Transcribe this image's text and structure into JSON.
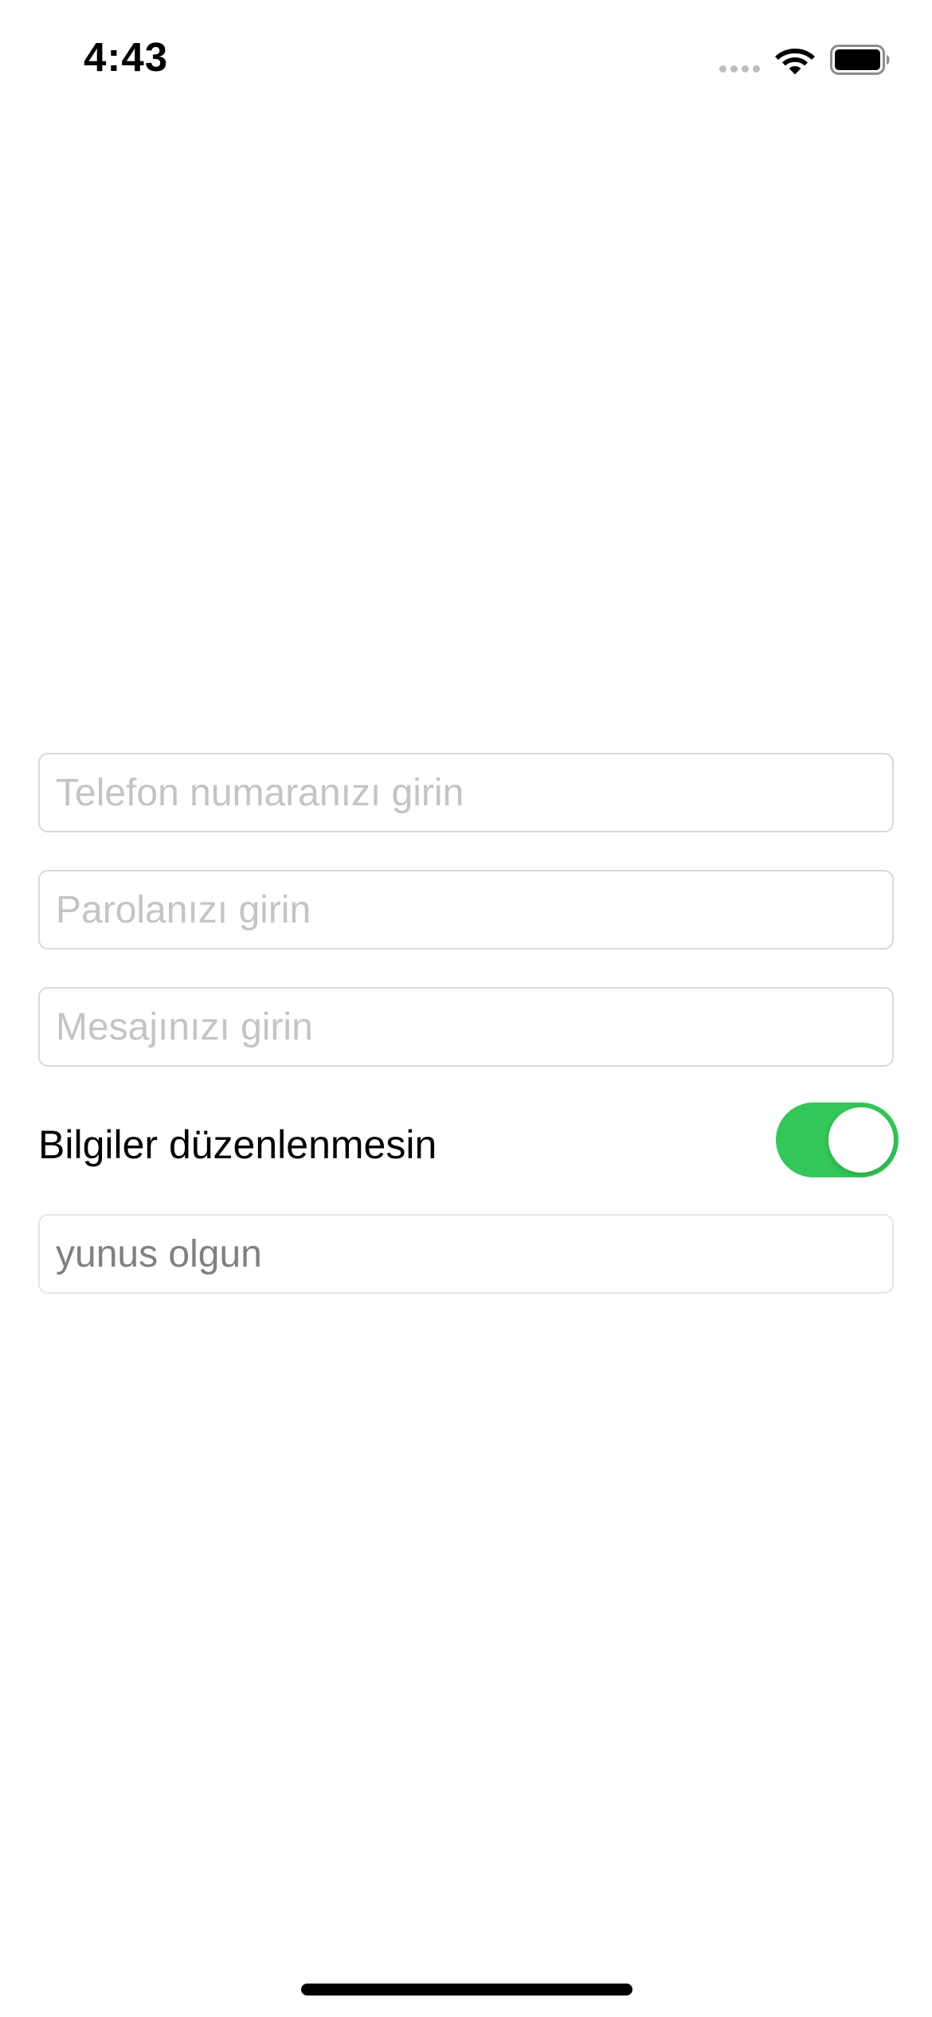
{
  "status_bar": {
    "time": "4:43",
    "icons": [
      "cellular-signal-icon",
      "wifi-icon",
      "battery-icon"
    ]
  },
  "form": {
    "phone_placeholder": "Telefon numaranızı girin",
    "phone_value": "",
    "password_placeholder": "Parolanızı girin",
    "password_value": "",
    "message_placeholder": "Mesajınızı girin",
    "message_value": "",
    "toggle_label": "Bilgiler düzenlenmesin",
    "toggle_on": true,
    "name_value": "yunus olgun"
  },
  "colors": {
    "toggle_on": "#34c759",
    "placeholder": "#c4c4c6",
    "field_border": "#d9d9d9",
    "disabled_text": "#808080"
  }
}
